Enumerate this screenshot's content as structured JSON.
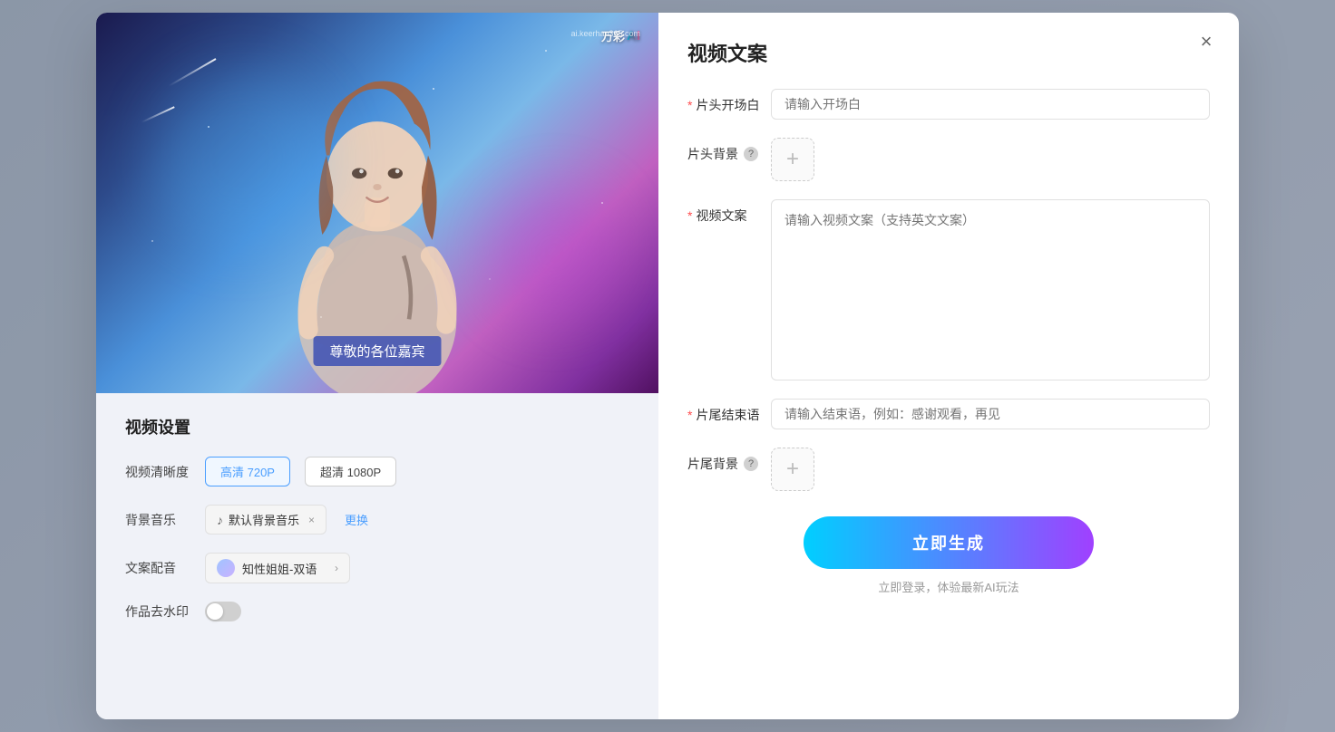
{
  "modal": {
    "close_label": "×"
  },
  "video_preview": {
    "watermark_text": "万彩",
    "watermark_ai": "AI",
    "watermark_sub": "ai.keerhan365.com",
    "subtitle": "尊敬的各位嘉宾"
  },
  "settings": {
    "title": "视频设置",
    "quality_label": "视频清晰度",
    "quality_hd_label": "高清 720P",
    "quality_fhd_label": "超清 1080P",
    "music_label": "背景音乐",
    "music_default": "默认背景音乐",
    "music_change": "更换",
    "voice_label": "文案配音",
    "voice_name": "知性姐姐-双语",
    "watermark_label": "作品去水印"
  },
  "form": {
    "title": "视频文案",
    "opening_label": "片头开场白",
    "opening_required": "*",
    "opening_placeholder": "请输入开场白",
    "bg_intro_label": "片头背景",
    "bg_add_icon": "+",
    "content_label": "视频文案",
    "content_required": "*",
    "content_placeholder": "请输入视频文案（支持英文文案）",
    "closing_label": "片尾结束语",
    "closing_required": "*",
    "closing_placeholder": "请输入结束语，例如：感谢观看，再见",
    "bg_outro_label": "片尾背景",
    "generate_btn": "立即生成",
    "login_hint": "立即登录，体验最新AI玩法"
  }
}
